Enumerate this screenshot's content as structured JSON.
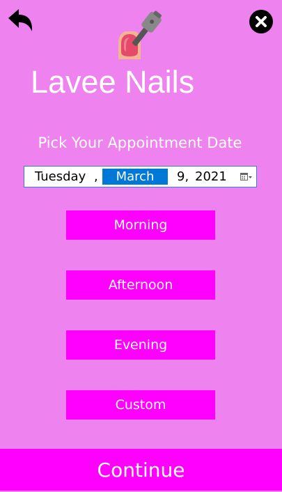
{
  "header": {
    "back_icon": "back-arrow-icon",
    "close_icon": "close-icon",
    "logo_icon": "nail-polish-icon"
  },
  "app": {
    "title": "Lavee Nails",
    "subtitle": "Pick Your Appointment Date"
  },
  "date_picker": {
    "weekday": "Tuesday",
    "separator": ",",
    "month": "March",
    "day": "9,",
    "year": "2021",
    "calendar_icon": "calendar-dropdown-icon"
  },
  "time_slots": [
    {
      "label": "Morning"
    },
    {
      "label": "Afternoon"
    },
    {
      "label": "Evening"
    },
    {
      "label": "Custom"
    }
  ],
  "footer": {
    "continue_label": "Continue"
  },
  "colors": {
    "background": "#ee82ee",
    "button": "#ff00ff",
    "selection": "#0078d7",
    "text": "#ffffff"
  }
}
